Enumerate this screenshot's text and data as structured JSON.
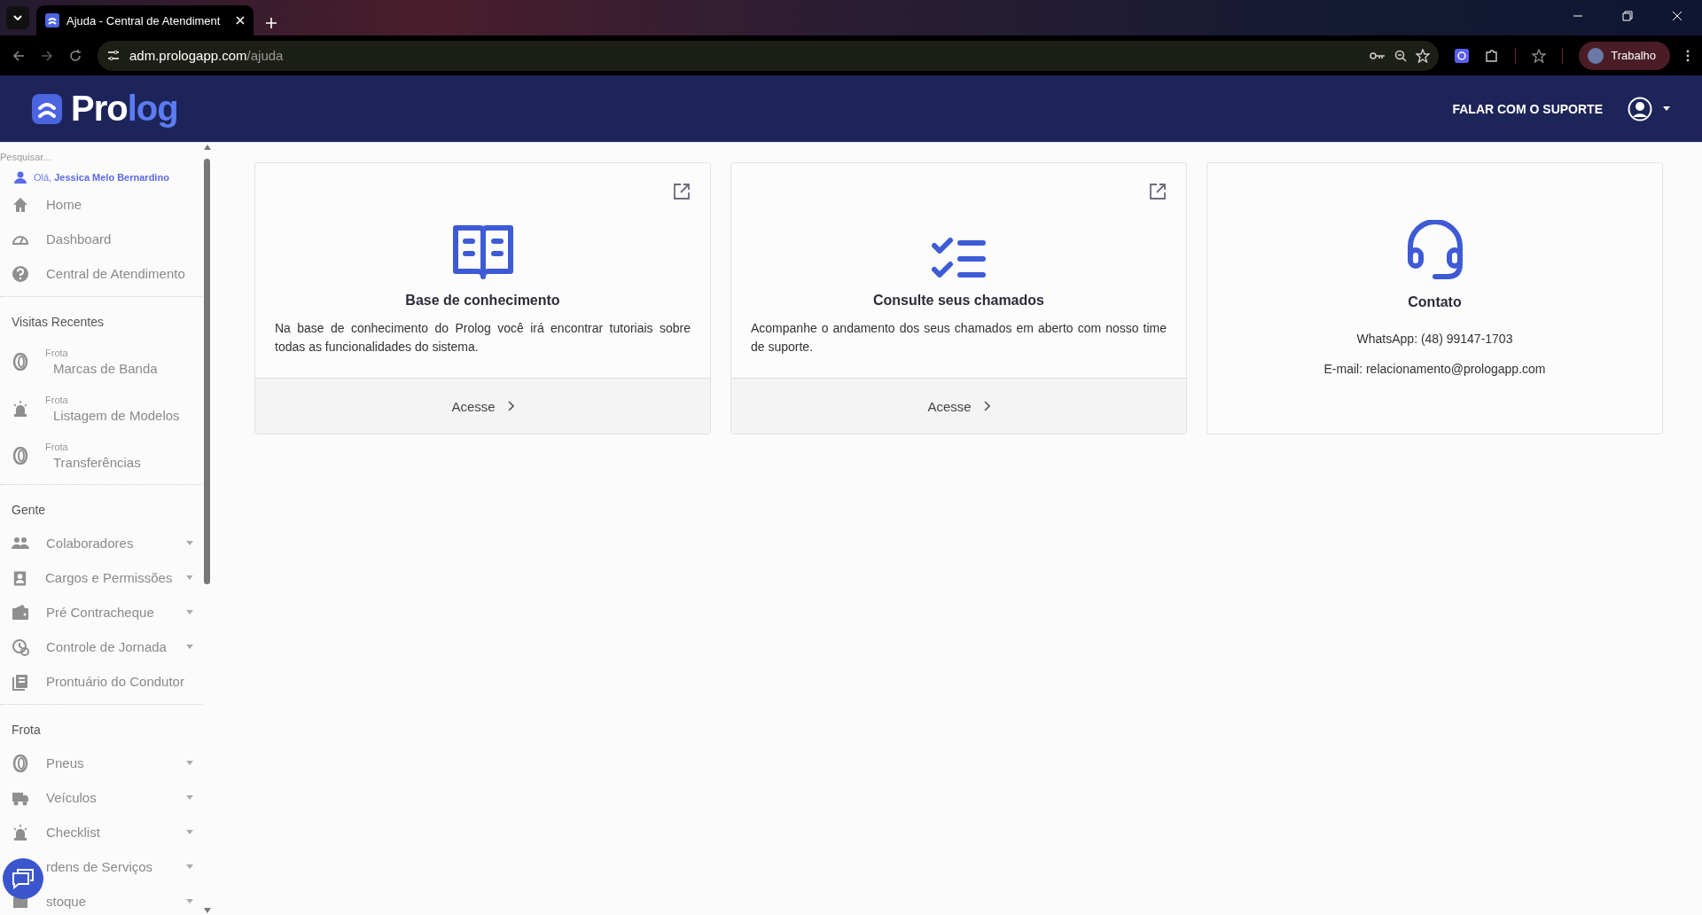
{
  "browser": {
    "tab_title": "Ajuda - Central de Atendiment",
    "url_host": "adm.prologapp.com",
    "url_path": "/ajuda",
    "profile": "Trabalho"
  },
  "header": {
    "logo": [
      "Pro",
      "log"
    ],
    "support_link": "FALAR COM O SUPORTE"
  },
  "sidebar": {
    "search": {
      "placeholder": "Pesquisar..."
    },
    "greeting": "Olá,",
    "user": "Jessica Melo Bernardino",
    "main_items": [
      {
        "label": "Home"
      },
      {
        "label": "Dashboard"
      },
      {
        "label": "Central de Atendimento"
      }
    ],
    "recent_title": "Visitas Recentes",
    "recent": [
      {
        "module": "Frota",
        "label": "Marcas de Banda"
      },
      {
        "module": "Frota",
        "label": "Listagem de Modelos"
      },
      {
        "module": "Frota",
        "label": "Transferências"
      }
    ],
    "sections": [
      {
        "title": "Gente",
        "items": [
          {
            "label": "Colaboradores",
            "expandable": true
          },
          {
            "label": "Cargos e Permissões",
            "expandable": true
          },
          {
            "label": "Pré Contracheque",
            "expandable": true
          },
          {
            "label": "Controle de Jornada",
            "expandable": true
          },
          {
            "label": "Prontuário do Condutor",
            "expandable": false
          }
        ]
      },
      {
        "title": "Frota",
        "items": [
          {
            "label": "Pneus",
            "expandable": true
          },
          {
            "label": "Veículos",
            "expandable": true
          },
          {
            "label": "Checklist",
            "expandable": true
          },
          {
            "label": "rdens de Serviços",
            "expandable": true
          },
          {
            "label": "stoque",
            "expandable": true
          }
        ]
      }
    ]
  },
  "cards": [
    {
      "kind": "link",
      "title": "Base de conhecimento",
      "text": "Na base de conhecimento do Prolog você irá encontrar tutoriais sobre todas as funcionalidades do sistema.",
      "action": "Acesse"
    },
    {
      "kind": "link",
      "title": "Consulte seus chamados",
      "text": "Acompanhe o andamento dos seus chamados em aberto com nosso time de suporte.",
      "action": "Acesse"
    },
    {
      "kind": "contact",
      "title": "Contato",
      "lines": [
        "WhatsApp: (48) 99147-1703",
        "E-mail: relacionamento@prologapp.com"
      ]
    }
  ]
}
